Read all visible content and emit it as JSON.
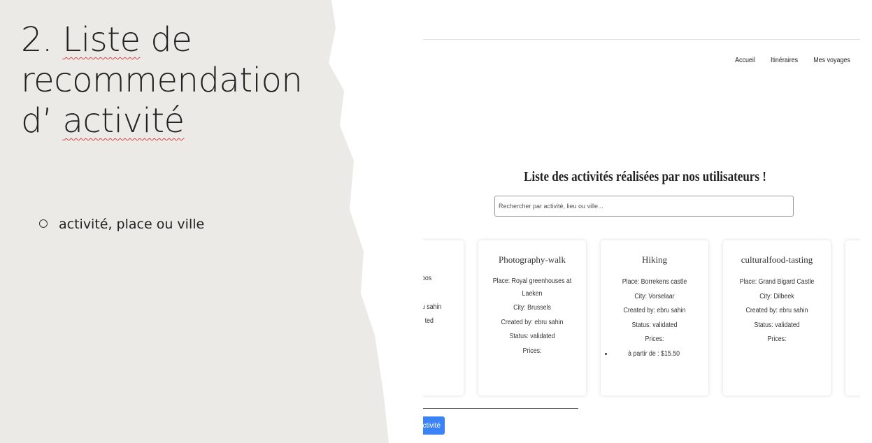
{
  "slide": {
    "title_prefix": "2. ",
    "title_w1": "Liste",
    "title_mid1": " de",
    "title_line2": "recommendation",
    "title_prefix3": "d’ ",
    "title_w3": "activité",
    "bullet": "activité, place ou ville"
  },
  "app": {
    "nav": [
      "Accueil",
      "Itinéraires",
      "Mes voyages"
    ],
    "page_title": "Liste des activités réalisées par nos utilisateurs !",
    "search_placeholder": "Rechercher par activité, lieu ou ville...",
    "partial_card": {
      "line1": "bos",
      "line2": "u sahin",
      "line3": "ted"
    },
    "cards": [
      {
        "title": "Photography-walk",
        "place": "Place: Royal greenhouses at",
        "place2": "Laeken",
        "city": "City: Brussels",
        "created": "Created by: ebru sahin",
        "status": "Status: validated",
        "prices": "Prices:"
      },
      {
        "title": "Hiking",
        "place": "Place: Borrekens castle",
        "city": "City: Vorselaar",
        "created": "Created by: ebru sahin",
        "status": "Status: validated",
        "prices": "Prices:",
        "price_item": "à partir de : $15.50"
      },
      {
        "title": "culturalfood-tasting",
        "place": "Place: Grand Bigard Castle",
        "city": "City: Dilbeek",
        "created": "Created by: ebru sahin",
        "status": "Status: validated",
        "prices": "Prices:"
      }
    ],
    "add_button": "ctivité",
    "colors": {
      "button": "#3b82f6",
      "slide_bg": "#ebeae7"
    }
  }
}
